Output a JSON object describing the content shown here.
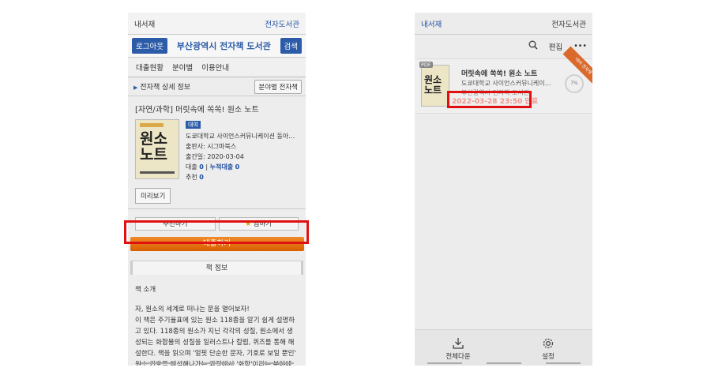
{
  "left": {
    "top_left": "내서재",
    "top_right": "전자도서관",
    "logout": "로그아웃",
    "title": "부산광역시 전자책 도서관",
    "search": "검색",
    "nav": [
      "대출현황",
      "분야별",
      "이용안내"
    ],
    "section_title": "전자책 상세 정보",
    "section_btn": "분야별 전자책",
    "book_title": "[자연/과학] 머릿속에 쏙쏙! 원소 노트",
    "badge": "대여",
    "cover_text": "원소\n노트",
    "author": "도쿄대학교 사이언스커뮤니케이션 동아리 ...",
    "publisher": "출판사: 시그마북스",
    "pubdate": "출간일: 2020-03-04",
    "loan_label": "대출",
    "loan_count": "0",
    "sep": " | ",
    "cum_label": "누적대출",
    "cum_count": "0",
    "rec_label": "추천",
    "rec_count": "0",
    "preview": "미리보기",
    "recommend": "추천하기",
    "favorite_star": "★",
    "favorite": "찜하기",
    "borrow": "대출하기",
    "book_info_tab": "책 정보",
    "intro_title": "책 소개",
    "intro_lines": [
      "자, 원소의 세계로 떠나는 문을 열어보자!",
      "이 책은 주기율표에 있는 원소 118종을 알기 쉽게 설명하",
      "고 있다. 118종의 원소가 지닌 각각의 성질, 원소에서 생",
      "성되는 화합물의 성질을 일러스트나 칼럼, 퀴즈를 통해 해",
      "설한다. 책을 읽으며 '얼핏 단순한 문자, 기호로 보일 뿐인'",
      "원소 기호를 해석해나가는 과정에서 '화학'이라는 분야에"
    ]
  },
  "right": {
    "top_left": "내서재",
    "top_right": "전자도서관",
    "edit": "편집",
    "more": "•••",
    "pdf": "PDF",
    "cover_text": "원소\n노트",
    "book_title": "머릿속에 쏙쏙! 원소 노트",
    "author": "도쿄대학교 사이언스커뮤니케이션 동아...",
    "publisher_partial": "부산광역시 전자책 도서관",
    "due_date": "2022-03-28 23:50 만료",
    "progress": "7%",
    "ribbon": "대여 전자책",
    "download_all": "전체다운",
    "settings": "설정"
  }
}
